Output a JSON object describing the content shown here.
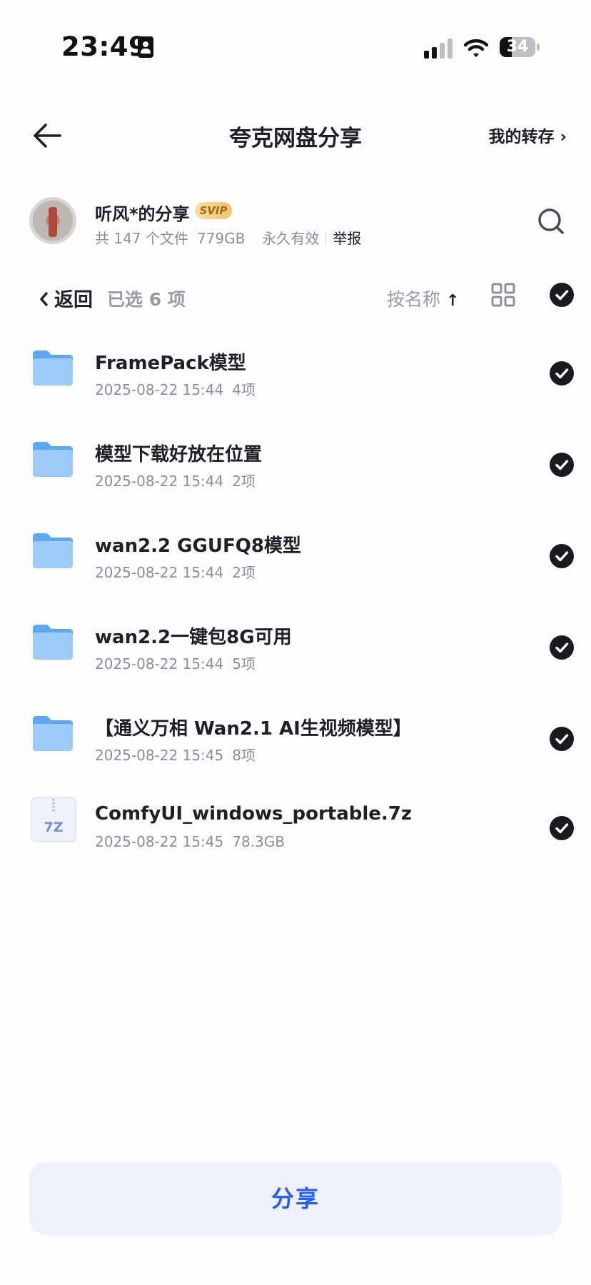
{
  "status_bar": {
    "time": "23:49",
    "battery_percent": "34",
    "battery_level": 0.34,
    "signal_bars": 2,
    "icons": [
      "contact-card-icon",
      "cellular-signal-icon",
      "wifi-icon",
      "battery-icon"
    ]
  },
  "header": {
    "title": "夸克网盘分享",
    "my_saves": "我的转存 ›"
  },
  "sharer": {
    "name": "听风*的分享",
    "badge": "SVIP",
    "file_count": "共 147 个文件",
    "total_size": "779GB",
    "validity": "永久有效",
    "report": "举报"
  },
  "toolbar": {
    "back": "返回",
    "selected": "已选 6 项",
    "sort": "按名称",
    "sort_arrow": "↑"
  },
  "files": [
    {
      "name": "FramePack模型",
      "date": "2025-08-22 15:44",
      "size": "4项",
      "type": "folder",
      "checked": true
    },
    {
      "name": "模型下载好放在位置",
      "date": "2025-08-22 15:44",
      "size": "2项",
      "type": "folder",
      "checked": true
    },
    {
      "name": "wan2.2 GGUFQ8模型",
      "date": "2025-08-22 15:44",
      "size": "2项",
      "type": "folder",
      "checked": true
    },
    {
      "name": "wan2.2一键包8G可用",
      "date": "2025-08-22 15:44",
      "size": "5项",
      "type": "folder",
      "checked": true
    },
    {
      "name": "【通义万相 Wan2.1 AI生视频模型】",
      "date": "2025-08-22 15:45",
      "size": "8项",
      "type": "folder",
      "checked": true
    },
    {
      "name": "ComfyUI_windows_portable.7z",
      "date": "2025-08-22 15:45",
      "size": "78.3GB",
      "type": "7z",
      "checked": true,
      "icon_label": "7Z"
    }
  ],
  "footer": {
    "share": "分享"
  },
  "colors": {
    "accent": "#2660e6",
    "folder": "#8fc2f8",
    "check": "#1b1b1f",
    "button_bg": "#eef0fb"
  }
}
